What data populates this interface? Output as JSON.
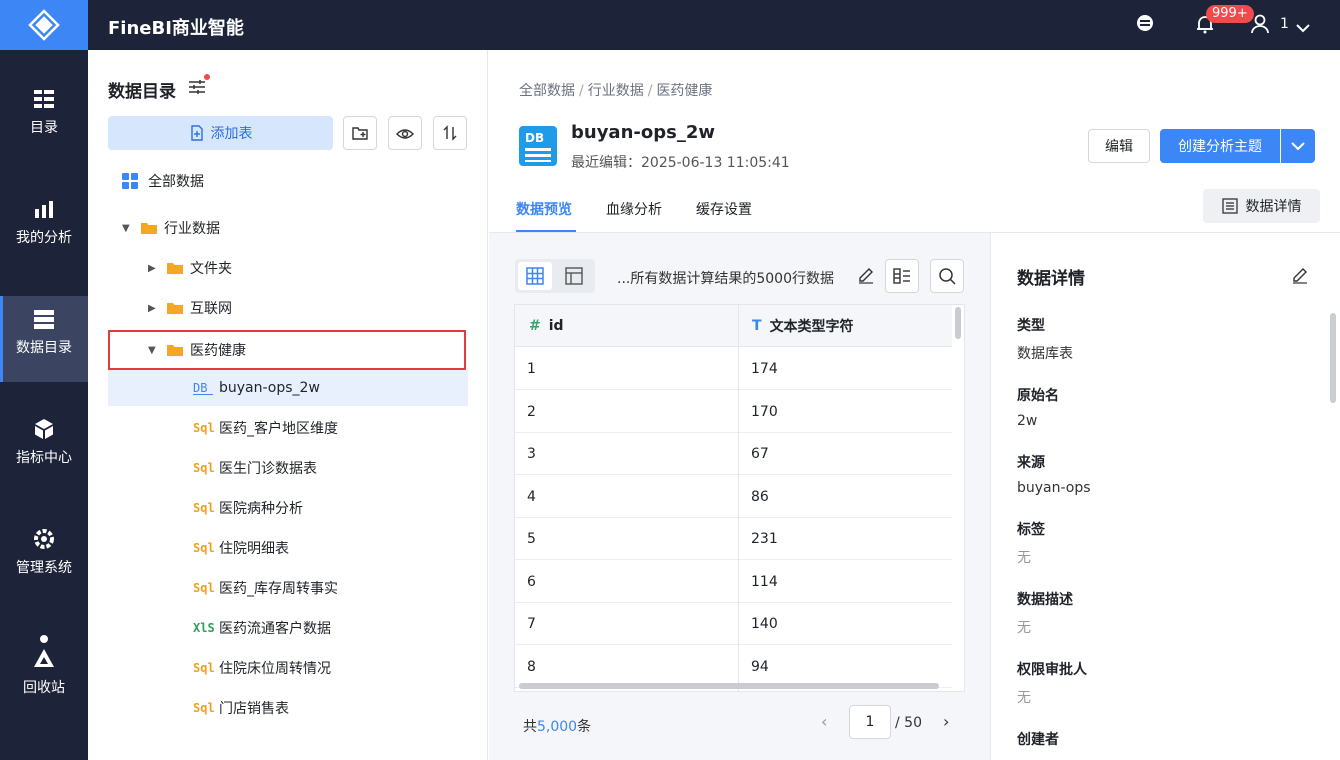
{
  "app": {
    "title": "FineBI商业智能",
    "notification_count": "999+",
    "user": "1"
  },
  "nav": [
    {
      "label": "目录",
      "icon": "catalog-icon"
    },
    {
      "label": "我的分析",
      "icon": "analysis-icon"
    },
    {
      "label": "数据目录",
      "icon": "data-catalog-icon",
      "active": true
    },
    {
      "label": "指标中心",
      "icon": "metrics-icon"
    },
    {
      "label": "管理系统",
      "icon": "settings-icon"
    },
    {
      "label": "回收站",
      "icon": "recycle-icon"
    }
  ],
  "catalog": {
    "title": "数据目录",
    "add_table": "添加表",
    "tree": [
      {
        "label": "全部数据",
        "type": "all"
      },
      {
        "label": "行业数据",
        "type": "folder",
        "expanded": true
      },
      {
        "label": "文件夹",
        "type": "folder"
      },
      {
        "label": "互联网",
        "type": "folder"
      },
      {
        "label": "医药健康",
        "type": "folder",
        "expanded": true
      },
      {
        "label": "buyan-ops_2w",
        "type": "db"
      },
      {
        "label": "医药_客户地区维度",
        "type": "sql"
      },
      {
        "label": "医生门诊数据表",
        "type": "sql"
      },
      {
        "label": "医院病种分析",
        "type": "sql"
      },
      {
        "label": "住院明细表",
        "type": "sql"
      },
      {
        "label": "医药_库存周转事实",
        "type": "sql"
      },
      {
        "label": "医药流通客户数据",
        "type": "xls"
      },
      {
        "label": "住院床位周转情况",
        "type": "sql"
      },
      {
        "label": "门店销售表",
        "type": "sql"
      }
    ]
  },
  "breadcrumb": [
    "全部数据",
    "行业数据",
    "医药健康"
  ],
  "table": {
    "name": "buyan-ops_2w",
    "last_edited": "最近编辑：2025-06-13 11:05:41",
    "edit_label": "编辑",
    "create_label": "创建分析主题"
  },
  "tabs": [
    "数据预览",
    "血缘分析",
    "缓存设置"
  ],
  "detail_button": "数据详情",
  "preview": {
    "limit_text": "...所有数据计算结果的5000行数据",
    "columns": [
      {
        "name": "id",
        "type_icon": "number-icon"
      },
      {
        "name": "文本类型字符",
        "type_icon": "text-icon"
      }
    ],
    "rows": [
      [
        "1",
        "174"
      ],
      [
        "2",
        "170"
      ],
      [
        "3",
        "67"
      ],
      [
        "4",
        "86"
      ],
      [
        "5",
        "231"
      ],
      [
        "6",
        "114"
      ],
      [
        "7",
        "140"
      ],
      [
        "8",
        "94"
      ]
    ],
    "total_prefix": "共",
    "total_count": "5,000",
    "total_suffix": "条",
    "page": "1",
    "page_of": "/ 50"
  },
  "details": {
    "title": "数据详情",
    "fields": [
      {
        "label": "类型",
        "value": "数据库表"
      },
      {
        "label": "原始名",
        "value": "2w"
      },
      {
        "label": "来源",
        "value": "buyan-ops"
      },
      {
        "label": "标签",
        "value": "无"
      },
      {
        "label": "数据描述",
        "value": "无"
      },
      {
        "label": "权限审批人",
        "value": "无"
      },
      {
        "label": "创建者",
        "value": ""
      }
    ]
  },
  "colors": {
    "accent": "#3d86f5",
    "nav_bg": "#1d2338",
    "highlight_box": "#e23b3b"
  }
}
